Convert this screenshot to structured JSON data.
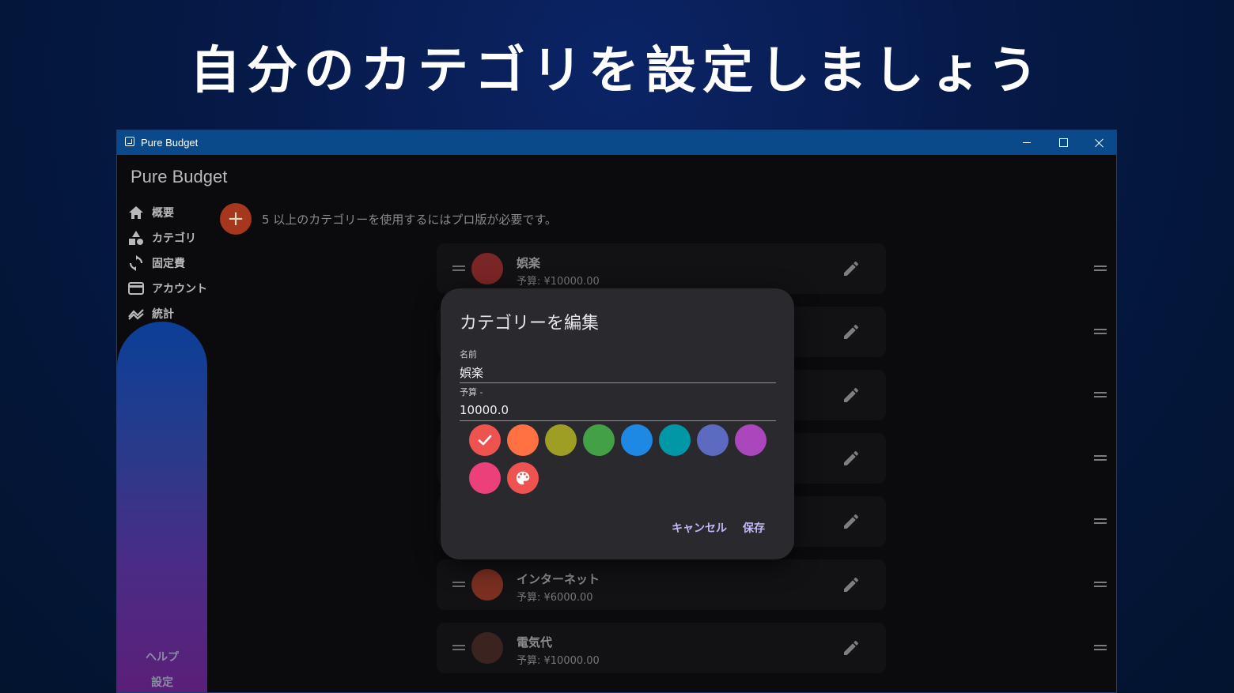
{
  "headline": "自分のカテゴリを設定しましょう",
  "window": {
    "title": "Pure Budget"
  },
  "app": {
    "brand": "Pure Budget",
    "pro_note": "5 以上のカテゴリーを使用するにはプロ版が必要です。",
    "nav": [
      {
        "label": "概要",
        "icon": "home-icon"
      },
      {
        "label": "カテゴリ",
        "icon": "shapes-icon"
      },
      {
        "label": "固定費",
        "icon": "sync-icon"
      },
      {
        "label": "アカウント",
        "icon": "card-icon"
      },
      {
        "label": "統計",
        "icon": "chart-line-icon"
      }
    ],
    "help": "ヘルプ",
    "settings": "設定"
  },
  "categories": [
    {
      "name": "娯楽",
      "budget": "予算: ¥10000.00",
      "color": "#7a2626"
    },
    {
      "name": "インターネット",
      "budget": "予算: ¥6000.00",
      "color": "#7a2f20"
    },
    {
      "name": "電気代",
      "budget": "予算: ¥10000.00",
      "color": "#3b2420"
    }
  ],
  "dialog": {
    "title": "カテゴリーを編集",
    "name_label": "名前",
    "name_value": "娯楽",
    "budget_label": "予算 -",
    "budget_value": "10000.0",
    "colors": [
      "#ef5350",
      "#ff7043",
      "#9e9d24",
      "#43a047",
      "#1e88e5",
      "#0097a7",
      "#5c6bc0",
      "#ab47bc",
      "#ec407a"
    ],
    "selected_color_index": 0,
    "custom_color_bg": "#ef5350",
    "cancel": "キャンセル",
    "save": "保存"
  }
}
